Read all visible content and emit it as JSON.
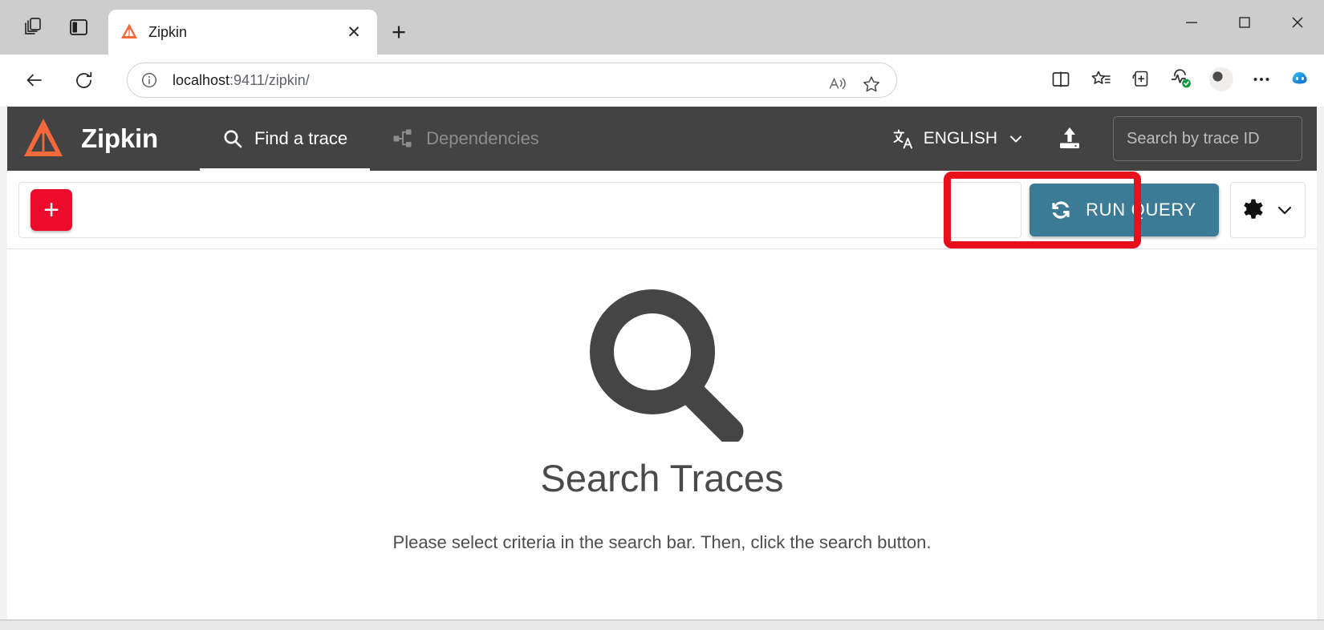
{
  "browser": {
    "tab": {
      "title": "Zipkin",
      "favicon": "zipkin-favicon",
      "close_label": "✕"
    },
    "new_tab_label": "+",
    "window_controls": {
      "minimize": "─",
      "maximize": "□",
      "close": "✕"
    },
    "address": {
      "scheme_host": "localhost",
      "path": ":9411/zipkin/",
      "full": "localhost:9411/zipkin/"
    },
    "nav": {
      "back": "back-arrow",
      "refresh": "refresh-arrow"
    },
    "omnibox_actions": [
      "read-aloud-icon",
      "favorite-star-icon"
    ],
    "toolbar_icons": [
      "split-screen-icon",
      "favorites-icon",
      "collections-icon",
      "browser-essentials-icon",
      "profile-avatar",
      "settings-more-icon",
      "copilot-icon"
    ]
  },
  "app": {
    "brand": "Zipkin",
    "tabs": [
      {
        "label": "Find a trace",
        "icon": "search-icon",
        "active": true
      },
      {
        "label": "Dependencies",
        "icon": "dependency-tree-icon",
        "active": false
      }
    ],
    "language": {
      "label": "ENGLISH",
      "icon": "translate-icon",
      "chevron": "chevron-down-icon"
    },
    "upload": {
      "icon": "upload-icon"
    },
    "trace_id_search": {
      "placeholder": "Search by trace ID",
      "value": ""
    }
  },
  "searchbar": {
    "add_criteria_label": "+",
    "run_query_label": "RUN QUERY",
    "run_query_icon": "refresh-cycle-icon",
    "settings_icon": "gear-icon",
    "settings_chevron": "chevron-down-icon"
  },
  "empty_state": {
    "illustration": "magnifying-glass-icon",
    "title": "Search Traces",
    "subtitle": "Please select criteria in the search bar. Then, click the search button."
  },
  "colors": {
    "navbar_bg": "#434343",
    "brand_orange": "#f5683c",
    "run_query_blue": "#3c7b96",
    "add_red": "#ec0b2b",
    "annotation_red": "#e8111b",
    "empty_gray": "#4a4a4a"
  }
}
